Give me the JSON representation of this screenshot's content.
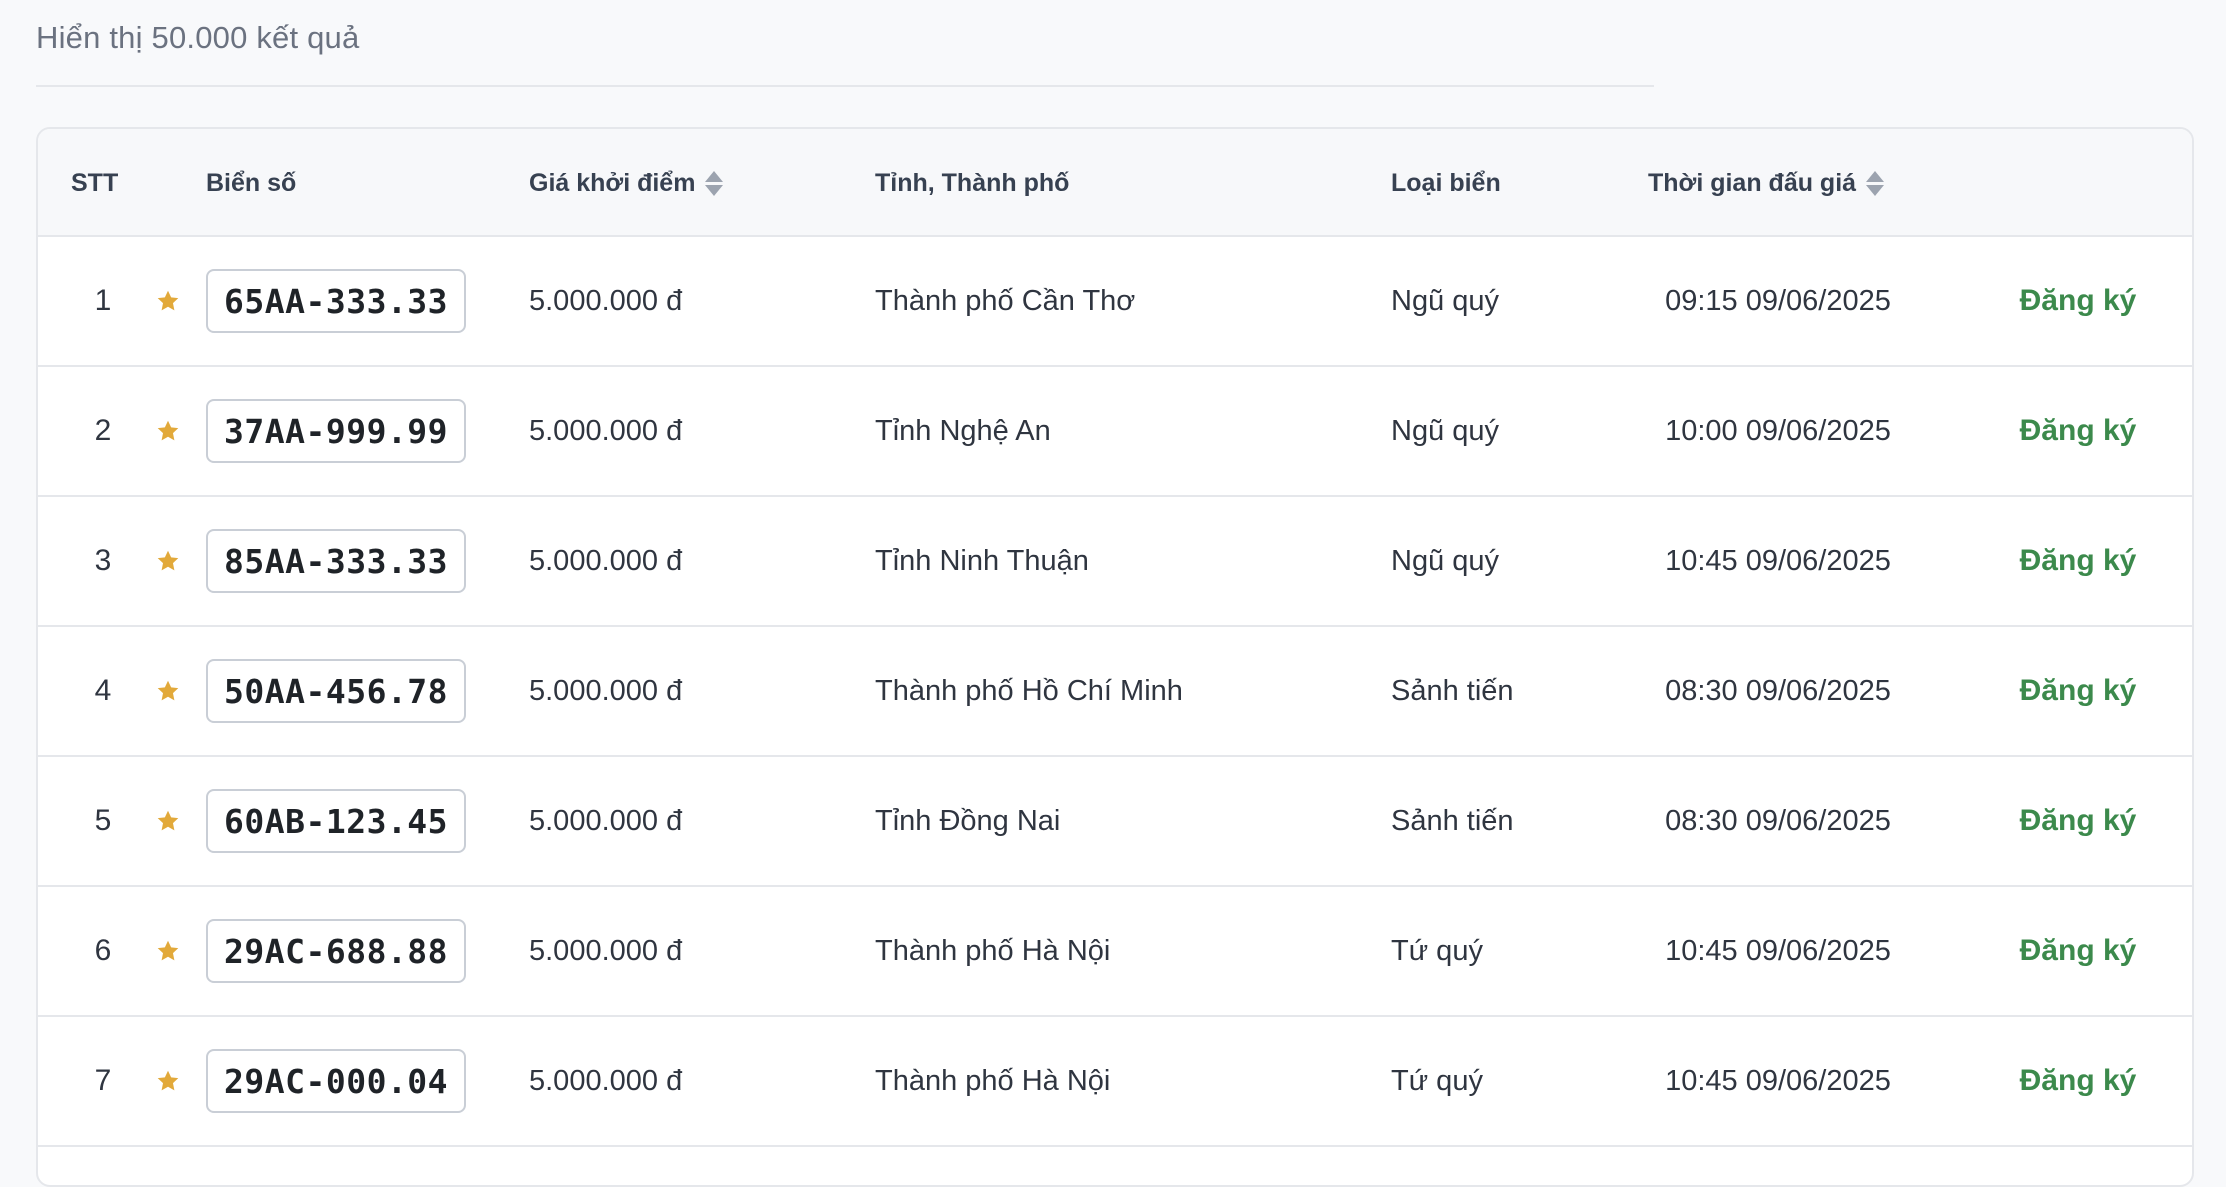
{
  "summary": {
    "result_text": "Hiển thị 50.000 kết quả"
  },
  "table": {
    "headers": {
      "stt": "STT",
      "plate": "Biển số",
      "price": "Giá khởi điểm",
      "province": "Tỉnh, Thành phố",
      "type": "Loại biển",
      "time": "Thời gian đấu giá"
    },
    "rows": [
      {
        "stt": "1",
        "plate": "65AA-333.33",
        "price": "5.000.000 đ",
        "province": "Thành phố Cần Thơ",
        "type": "Ngũ quý",
        "time": "09:15 09/06/2025",
        "action": "Đăng ký"
      },
      {
        "stt": "2",
        "plate": "37AA-999.99",
        "price": "5.000.000 đ",
        "province": "Tỉnh Nghệ An",
        "type": "Ngũ quý",
        "time": "10:00 09/06/2025",
        "action": "Đăng ký"
      },
      {
        "stt": "3",
        "plate": "85AA-333.33",
        "price": "5.000.000 đ",
        "province": "Tỉnh Ninh Thuận",
        "type": "Ngũ quý",
        "time": "10:45 09/06/2025",
        "action": "Đăng ký"
      },
      {
        "stt": "4",
        "plate": "50AA-456.78",
        "price": "5.000.000 đ",
        "province": "Thành phố Hồ Chí Minh",
        "type": "Sảnh tiến",
        "time": "08:30 09/06/2025",
        "action": "Đăng ký"
      },
      {
        "stt": "5",
        "plate": "60AB-123.45",
        "price": "5.000.000 đ",
        "province": "Tỉnh Đồng Nai",
        "type": "Sảnh tiến",
        "time": "08:30 09/06/2025",
        "action": "Đăng ký"
      },
      {
        "stt": "6",
        "plate": "29AC-688.88",
        "price": "5.000.000 đ",
        "province": "Thành phố Hà Nội",
        "type": "Tứ quý",
        "time": "10:45 09/06/2025",
        "action": "Đăng ký"
      },
      {
        "stt": "7",
        "plate": "29AC-000.04",
        "price": "5.000.000 đ",
        "province": "Thành phố Hà Nội",
        "type": "Tứ quý",
        "time": "10:45 09/06/2025",
        "action": "Đăng ký"
      }
    ]
  },
  "icons": {
    "favorite": "star-icon",
    "sort": "sort-icon"
  },
  "colors": {
    "star": "#e2a93a",
    "action": "#3c8a4c",
    "border": "#e5e7eb"
  }
}
